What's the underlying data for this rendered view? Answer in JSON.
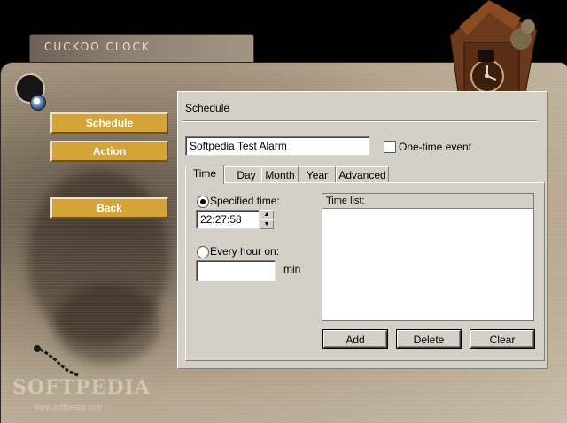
{
  "app": {
    "title": "CUCKOO CLOCK"
  },
  "nav": {
    "schedule": "Schedule",
    "action": "Action",
    "back": "Back"
  },
  "panel": {
    "title": "Schedule",
    "alarm_name": "Softpedia Test Alarm",
    "one_time_label": "One-time event",
    "one_time_checked": false,
    "tabs": [
      {
        "label": "Time",
        "active": true
      },
      {
        "label": "Day"
      },
      {
        "label": "Month"
      },
      {
        "label": "Year"
      },
      {
        "label": "Advanced"
      }
    ],
    "specified_time_label": "Specified time:",
    "specified_time_value": "22:27:58",
    "every_hour_label": "Every hour on:",
    "every_hour_value": "",
    "min_label": "min",
    "time_list_label": "Time list:",
    "buttons": {
      "add": "Add",
      "delete": "Delete",
      "clear": "Clear"
    }
  },
  "watermark": {
    "logo": "SOFTPEDIA",
    "url": "www.softpedia.com"
  },
  "colors": {
    "nav_button": "#d5a438",
    "panel": "#d4d0c8"
  }
}
